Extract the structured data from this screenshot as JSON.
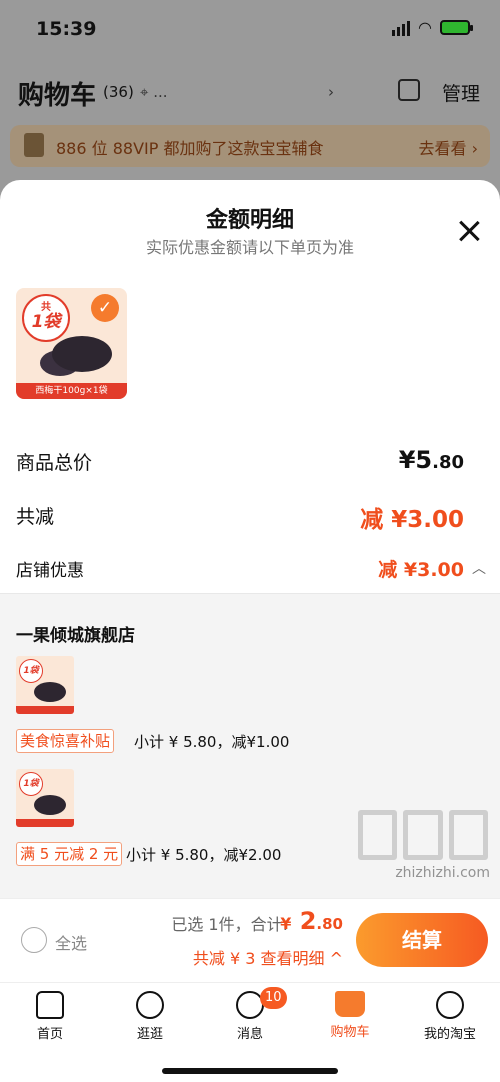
{
  "status": {
    "time": "15:39"
  },
  "cart_header": {
    "title": "购物车",
    "count": "(36)",
    "location": "...",
    "manage": "管理"
  },
  "promo": {
    "text": "886 位 88VIP 都加购了这款宝宝辅食",
    "link": "去看看 ›"
  },
  "sheet": {
    "title": "金额明细",
    "subtitle": "实际优惠金额请以下单页为准",
    "product_badge_small": "共",
    "product_badge_big": "1袋",
    "product_label": "西梅干100g×1袋",
    "rows": {
      "total_label": "商品总价",
      "total_currency": "¥",
      "total_int": "5",
      "total_dec": ".80",
      "reduce_label": "共减",
      "reduce_value": "减 ¥3.00",
      "shop_label": "店铺优惠",
      "shop_value": "减 ¥3.00"
    },
    "store": {
      "name": "一果倾城旗舰店",
      "items": [
        {
          "badge": "1袋",
          "tag": "美食惊喜补贴",
          "subtotal": "小计 ¥ 5.80，减¥1.00"
        },
        {
          "badge": "1袋",
          "tag": "满 5 元减 2 元",
          "subtotal": "小计 ¥ 5.80，减¥2.00"
        }
      ]
    }
  },
  "checkout": {
    "select_all": "全选",
    "selected_info": "已选 1件，合计:",
    "currency": "¥",
    "total_int": "2",
    "total_dec": ".80",
    "detail_link": "共减 ¥ 3  查看明细 ^",
    "button": "结算"
  },
  "tabs": [
    {
      "label": "首页"
    },
    {
      "label": "逛逛"
    },
    {
      "label": "消息",
      "badge": "10"
    },
    {
      "label": "购物车"
    },
    {
      "label": "我的淘宝"
    }
  ],
  "watermark": "zhizhizhi.com",
  "colors": {
    "accent": "#f04e1d",
    "checkout_start": "#fb9b2d",
    "checkout_end": "#f65a22"
  }
}
